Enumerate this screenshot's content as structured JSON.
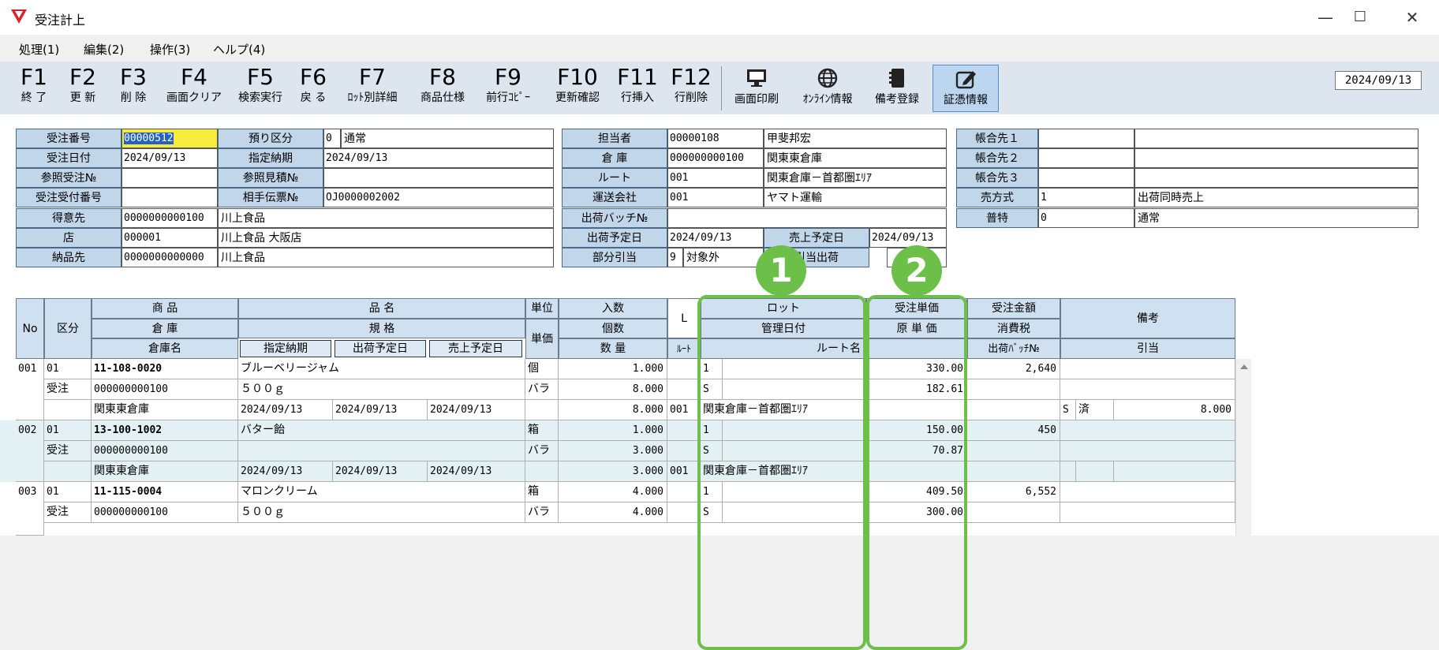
{
  "window": {
    "title": "受注計上",
    "minimize": "—",
    "maximize": "☐",
    "close": "✕"
  },
  "menu": [
    "処理(1)",
    "編集(2)",
    "操作(3)",
    "ヘルプ(4)"
  ],
  "fkeys": [
    {
      "key": "F1",
      "label": "終 了"
    },
    {
      "key": "F2",
      "label": "更 新"
    },
    {
      "key": "F3",
      "label": "削 除"
    },
    {
      "key": "F4",
      "label": "画面クリア"
    },
    {
      "key": "F5",
      "label": "検索実行"
    },
    {
      "key": "F6",
      "label": "戻 る"
    },
    {
      "key": "F7",
      "label": "ﾛｯﾄ別詳細"
    },
    {
      "key": "F8",
      "label": "商品仕様"
    },
    {
      "key": "F9",
      "label": "前行ｺﾋﾟｰ"
    },
    {
      "key": "F10",
      "label": "更新確認"
    },
    {
      "key": "F11",
      "label": "行挿入"
    },
    {
      "key": "F12",
      "label": "行削除"
    }
  ],
  "tools": [
    {
      "icon": "monitor-icon",
      "label": "画面印刷"
    },
    {
      "icon": "globe-icon",
      "label": "ｵﾝﾗｲﾝ情報"
    },
    {
      "icon": "notebook-icon",
      "label": "備考登録"
    },
    {
      "icon": "edit-icon",
      "label": "証憑情報"
    }
  ],
  "date": "2024/09/13",
  "form": {
    "order_no_label": "受注番号",
    "order_no": "00000512",
    "order_date_label": "受注日付",
    "order_date": "2024/09/13",
    "ref_order_label": "参照受注№",
    "ref_order": "",
    "order_recv_label": "受注受付番号",
    "order_recv": "",
    "customer_label": "得意先",
    "customer_code": "0000000000100",
    "customer_name": "川上食品",
    "store_label": "店",
    "store_code": "000001",
    "store_name": "川上食品 大阪店",
    "ship_to_label": "納品先",
    "ship_to_code": "0000000000000",
    "ship_to_name": "川上食品",
    "deposit_label": "預り区分",
    "deposit_code": "0",
    "deposit_name": "通常",
    "due_label": "指定納期",
    "due": "2024/09/13",
    "ref_quote_label": "参照見積№",
    "ref_quote": "",
    "partner_slip_label": "相手伝票№",
    "partner_slip": "OJ0000002002",
    "staff_label": "担当者",
    "staff_code": "00000108",
    "staff_name": "甲斐邦宏",
    "warehouse_label": "倉 庫",
    "warehouse_code": "000000000100",
    "warehouse_name": "関東東倉庫",
    "route_label": "ルート",
    "route_code": "001",
    "route_name": "関東倉庫－首都圏ｴﾘｱ",
    "carrier_label": "運送会社",
    "carrier_code": "001",
    "carrier_name": "ヤマト運輸",
    "batch_label": "出荷バッチ№",
    "batch": "",
    "ship_date_label": "出荷予定日",
    "ship_date": "2024/09/13",
    "sales_date_label": "売上予定日",
    "sales_date": "2024/09/13",
    "partial_label": "部分引当",
    "partial_code": "9",
    "partial_name": "対象外",
    "alloc_label": "引当出荷",
    "alloc": "",
    "acct1_label": "帳合先１",
    "acct2_label": "帳合先２",
    "acct3_label": "帳合先３",
    "sales_method_label": "売方式",
    "sales_method_code": "1",
    "sales_method_name": "出荷同時売上",
    "special_label": "普特",
    "special_code": "0",
    "special_name": "通常"
  },
  "grid_headers": {
    "no": "No",
    "kubun": "区分",
    "shohin": "商 品",
    "soko": "倉 庫",
    "sokomei": "倉庫名",
    "hinmei": "品 名",
    "kikaku": "規 格",
    "shitei": "指定納期",
    "shukka": "出荷予定日",
    "uriage": "売上予定日",
    "tani": "単位",
    "tanka": "単価",
    "irisu": "入数",
    "kosu": "個数",
    "suryo": "数 量",
    "L": "L",
    "route_s": "ﾙｰﾄ",
    "lot": "ロット",
    "kanri": "管理日付",
    "routemei": "ルート名",
    "juchu_tanka": "受注単価",
    "gen_tanka": "原 単 価",
    "juchu_kingaku": "受注金額",
    "shohizei": "消費税",
    "batch": "出荷ﾊﾞｯﾁ№",
    "biko": "備考",
    "hikiate": "引当"
  },
  "rows": [
    {
      "no": "001",
      "kubun": "01",
      "code": "11-108-0020",
      "name": "ブルーベリージャム",
      "unit": "個",
      "irisu": "1.000",
      "L": "1",
      "juchu_tanka": "330.00",
      "kingaku": "2,640",
      "kubun2": "受注",
      "soko": "000000000100",
      "kikaku": "５００ｇ",
      "unit2": "バラ",
      "kosu": "8.000",
      "L2": "S",
      "gen_tanka": "182.61",
      "sokomei": "関東東倉庫",
      "shitei": "2024/09/13",
      "shukka": "2024/09/13",
      "uriage": "2024/09/13",
      "suryo": "8.000",
      "route": "001",
      "routemei": "関東倉庫－首都圏ｴﾘｱ",
      "hk1": "S",
      "hk2": "済",
      "hk3": "8.000"
    },
    {
      "no": "002",
      "kubun": "01",
      "code": "13-100-1002",
      "name": "バター飴",
      "unit": "箱",
      "irisu": "1.000",
      "L": "1",
      "juchu_tanka": "150.00",
      "kingaku": "450",
      "kubun2": "受注",
      "soko": "000000000100",
      "kikaku": "",
      "unit2": "バラ",
      "kosu": "3.000",
      "L2": "S",
      "gen_tanka": "70.87",
      "sokomei": "関東東倉庫",
      "shitei": "2024/09/13",
      "shukka": "2024/09/13",
      "uriage": "2024/09/13",
      "suryo": "3.000",
      "route": "001",
      "routemei": "関東倉庫－首都圏ｴﾘｱ",
      "hk1": "",
      "hk2": "",
      "hk3": ""
    },
    {
      "no": "003",
      "kubun": "01",
      "code": "11-115-0004",
      "name": "マロンクリーム",
      "unit": "箱",
      "irisu": "4.000",
      "L": "1",
      "juchu_tanka": "409.50",
      "kingaku": "6,552",
      "kubun2": "受注",
      "soko": "000000000100",
      "kikaku": "５００ｇ",
      "unit2": "バラ",
      "kosu": "4.000",
      "L2": "S",
      "gen_tanka": "300.00"
    }
  ],
  "badges": [
    "1",
    "2"
  ],
  "colors": {
    "callout": "#6cc04a",
    "label_bg": "#c2d6ea",
    "row_alt": "#e3f1f5",
    "highlight": "#f5ec3d"
  }
}
